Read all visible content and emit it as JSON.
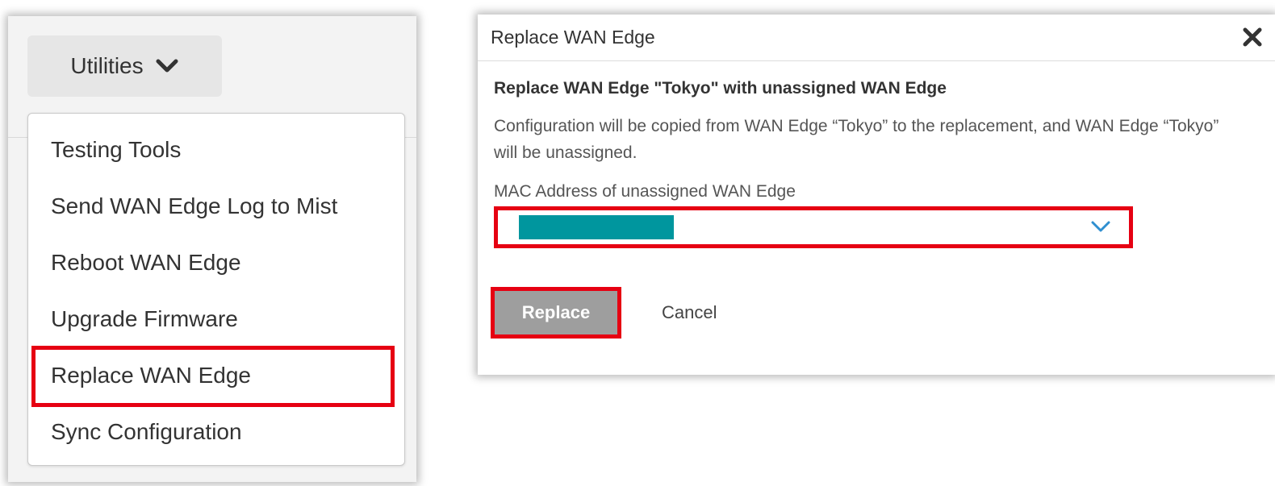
{
  "utilities": {
    "button_label": "Utilities",
    "menu_items": [
      {
        "label": "Testing Tools"
      },
      {
        "label": "Send WAN Edge Log to Mist"
      },
      {
        "label": "Reboot WAN Edge"
      },
      {
        "label": "Upgrade Firmware"
      },
      {
        "label": "Replace WAN Edge",
        "highlighted": true
      },
      {
        "label": "Sync Configuration"
      }
    ]
  },
  "modal": {
    "title": "Replace WAN Edge",
    "subtitle": "Replace WAN Edge \"Tokyo\" with unassigned WAN Edge",
    "description": "Configuration will be copied from WAN Edge “Tokyo” to the replacement, and WAN Edge “Tokyo” will be unassigned.",
    "mac_label": "MAC Address of unassigned WAN Edge",
    "mac_value_redacted": true,
    "replace_label": "Replace",
    "cancel_label": "Cancel"
  },
  "colors": {
    "highlight_border": "#e60012",
    "redaction": "#00969e",
    "primary_button": "#9e9e9e",
    "chevron_blue": "#2f8fd0"
  },
  "icons": {
    "utilities_chevron": "chevron-down-icon",
    "close": "close-icon",
    "select_chevron": "chevron-down-icon"
  }
}
